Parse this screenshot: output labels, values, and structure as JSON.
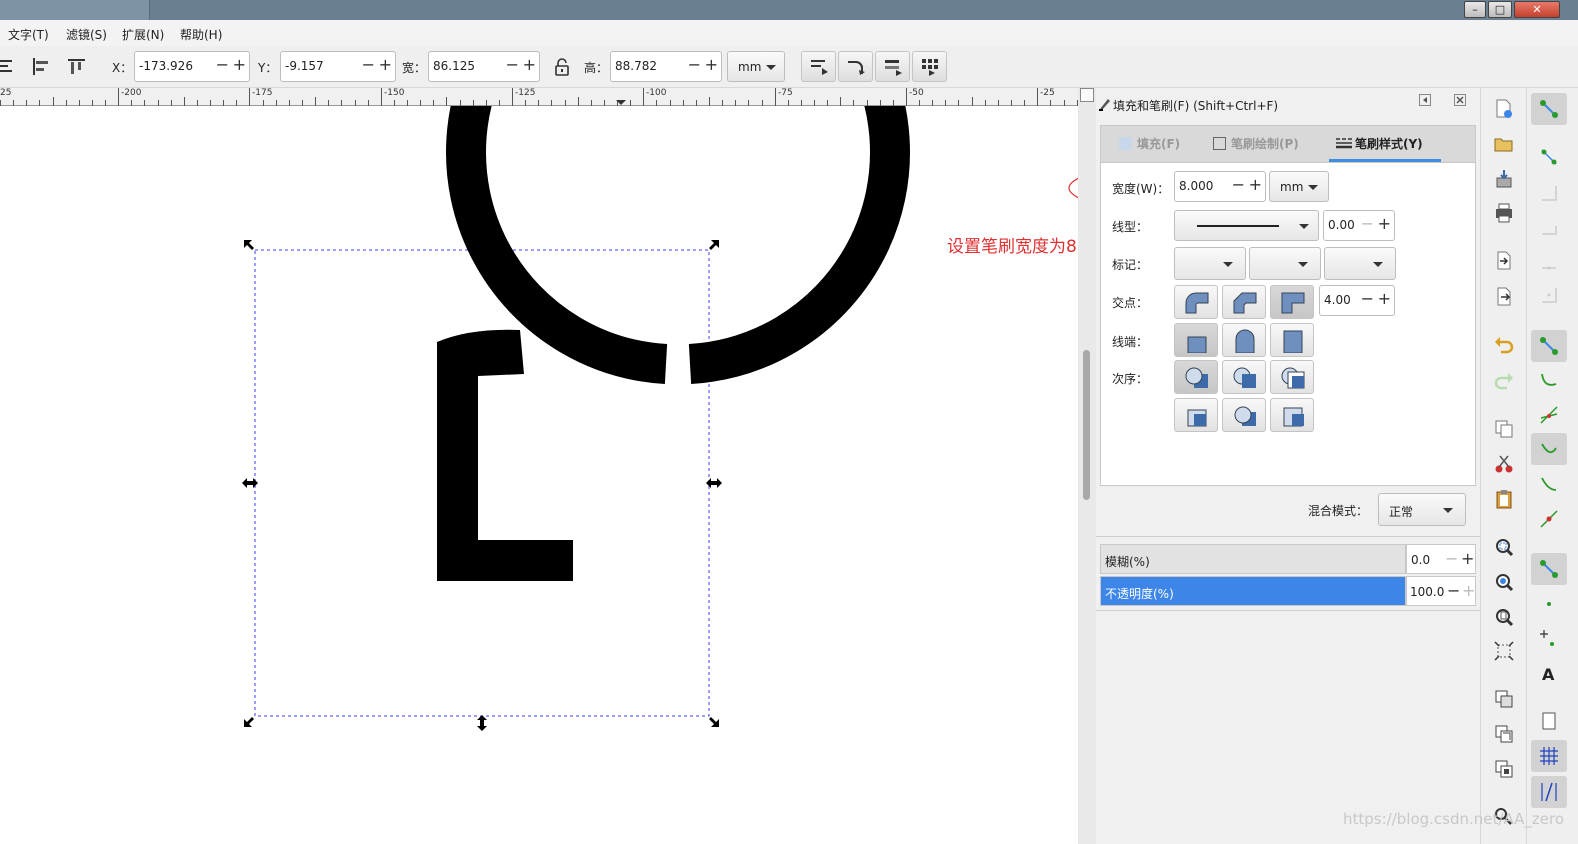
{
  "menu": {
    "items": [
      "文字(T)",
      "滤镜(S)",
      "扩展(N)",
      "帮助(H)"
    ]
  },
  "toolbar": {
    "x_label": "X：",
    "x_value": "-173.926",
    "y_label": "Y：",
    "y_value": "-9.157",
    "w_label": "宽：",
    "w_value": "86.125",
    "h_label": "高：",
    "h_value": "88.782",
    "unit": "mm"
  },
  "ruler": {
    "labels": [
      "25",
      "-200",
      "-175",
      "-150",
      "-125",
      "-100",
      "-75",
      "-50",
      "-25"
    ]
  },
  "panel": {
    "title": "填充和笔刷(F) (Shift+Ctrl+F)",
    "tabs": [
      {
        "label": "填充(F)",
        "active": false
      },
      {
        "label": "笔刷绘制(P)",
        "active": false
      },
      {
        "label": "笔刷样式(Y)",
        "active": true
      }
    ],
    "width_label": "宽度(W)：",
    "width_value": "8.000",
    "width_unit": "mm",
    "dash_label": "线型：",
    "dash_offset": "0.00",
    "markers_label": "标记：",
    "join_label": "交点：",
    "miter_value": "4.00",
    "cap_label": "线端：",
    "order_label": "次序：",
    "blend_label": "混合模式：",
    "blend_value": "正常",
    "blur_label": "模糊(%)",
    "blur_value": "0.0",
    "opacity_label": "不透明度(%)",
    "opacity_value": "100.0"
  },
  "annotation": {
    "text": "设置笔刷宽度为8",
    "color": "#e03030"
  },
  "watermark": "https://blog.csdn.net/AA_zero",
  "colors": {
    "accent": "#3d8ee0",
    "selection": "#3d86e8"
  }
}
